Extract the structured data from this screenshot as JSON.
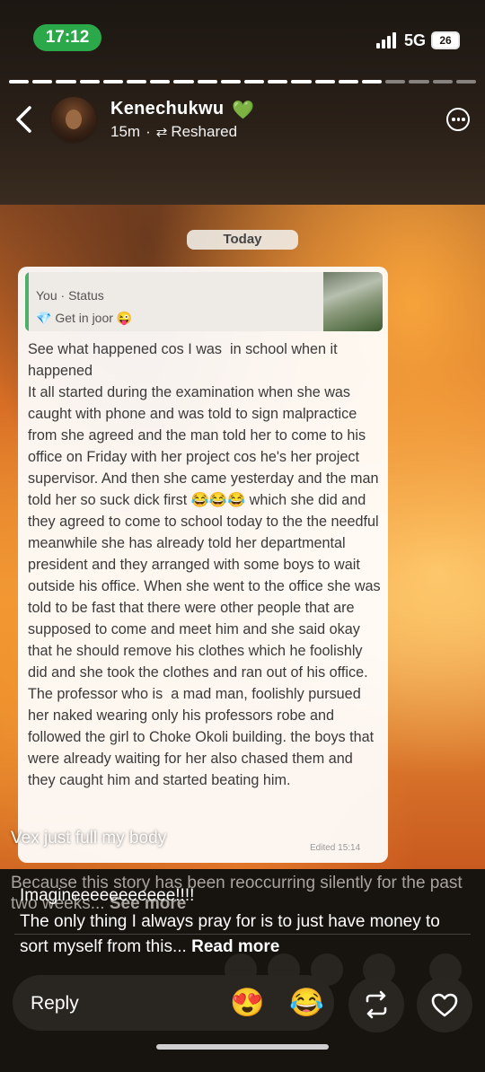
{
  "status_bar": {
    "time": "17:12",
    "network": "5G",
    "battery": "26"
  },
  "header": {
    "author_name": "Kenechukwu",
    "age": "15m",
    "reshared_label": "Reshared"
  },
  "chat": {
    "date_chip": "Today",
    "quote_title": "You · Status",
    "quote_status": "💎 Get in joor 😜",
    "message": "See what happened cos I was  in school when it happened\nIt all started during the examination when she was caught with phone and was told to sign malpractice from she agreed and the man told her to come to his office on Friday with her project cos he's her project supervisor. And then she came yesterday and the man told her so suck dick first 😂😂😂 which she did and they agreed to come to school today to the the needful meanwhile she has already told her departmental president and they arranged with some boys to wait outside his office. When she went to the office she was told to be fast that there were other people that are supposed to come and meet him and she said okay that he should remove his clothes which he foolishly did and she took the clothes and ran out of his office. The professor who is  a mad man, foolishly pursued her naked wearing only his professors robe and followed the girl to Choke Okoli building. the boys that were already waiting for her also chased them and they caught him and started beating him.",
    "edited_label": "Edited 15:14"
  },
  "captions": {
    "vex": "Vex just full my body",
    "story_text": "Because this story has been reoccurring silently for the past two weeks...",
    "see_more": "See more",
    "imagine": "Imagineeeeeeeeeee!!!!",
    "reply_text": "The only thing I always pray for is to just have money to sort myself from this...",
    "read_more": "Read more"
  },
  "reply_bar": {
    "reply_label": "Reply",
    "emoji_1": "😍",
    "emoji_2": "😂"
  },
  "icons": {
    "verified": "green-heart-icon",
    "back": "chevron-left-icon",
    "more": "more-options-icon",
    "repost": "repost-icon",
    "like": "heart-outline-icon"
  },
  "colors": {
    "accent_green": "#2ba84a",
    "heart_green": "#3ec24a",
    "quote_bar": "#4caf6a"
  },
  "story_progress": {
    "segments_total": 20,
    "segments_viewed": 16
  }
}
